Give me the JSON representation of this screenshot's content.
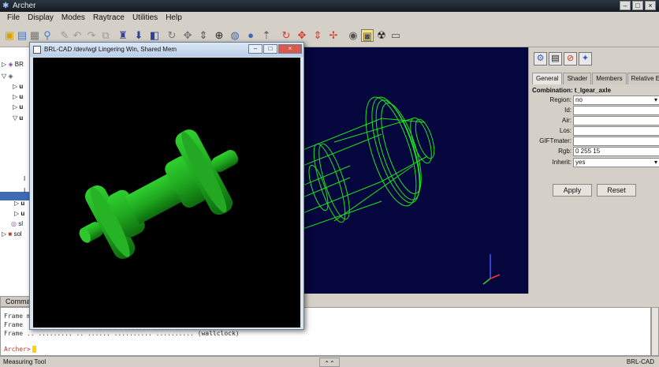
{
  "app": {
    "title": "Archer"
  },
  "menu": [
    "File",
    "Display",
    "Modes",
    "Raytrace",
    "Utilities",
    "Help"
  ],
  "tree": {
    "items": [
      "BR",
      "u",
      "u",
      "u",
      "u",
      "u",
      "u",
      "sl",
      "sol"
    ]
  },
  "properties": {
    "tabs": [
      "General",
      "Shader",
      "Members",
      "Relative Edit"
    ],
    "combination_label": "Combination:",
    "combination_name": "t_lgear_axle",
    "fields": [
      {
        "label": "Region:",
        "value": "no",
        "dropdown": true
      },
      {
        "label": "Id:",
        "value": ""
      },
      {
        "label": "Air:",
        "value": ""
      },
      {
        "label": "Los:",
        "value": ""
      },
      {
        "label": "GIFTmater:",
        "value": ""
      },
      {
        "label": "Rgb:",
        "value": "0 255 15"
      },
      {
        "label": "Inherit:",
        "value": "yes",
        "dropdown": true
      }
    ],
    "apply_label": "Apply",
    "reset_label": "Reset"
  },
  "command": {
    "tab_label": "Comma",
    "lines": [
      "Frame                                                              m)",
      "Frame",
      "Frame    ..    .........    ..     ......    .......... ..........  (wallclock)"
    ],
    "prompt": "Archer>"
  },
  "status": {
    "left": "Measuring Tool",
    "splitter": "⌃⌃",
    "right": "BRL-CAD"
  },
  "raytrace_window": {
    "title": "BRL-CAD /dev/wgl Lingering Win, Shared Mem"
  },
  "colors": {
    "viewport_bg": "#06063f",
    "wire_green": "#19e619",
    "solid_green": "#22b322"
  }
}
